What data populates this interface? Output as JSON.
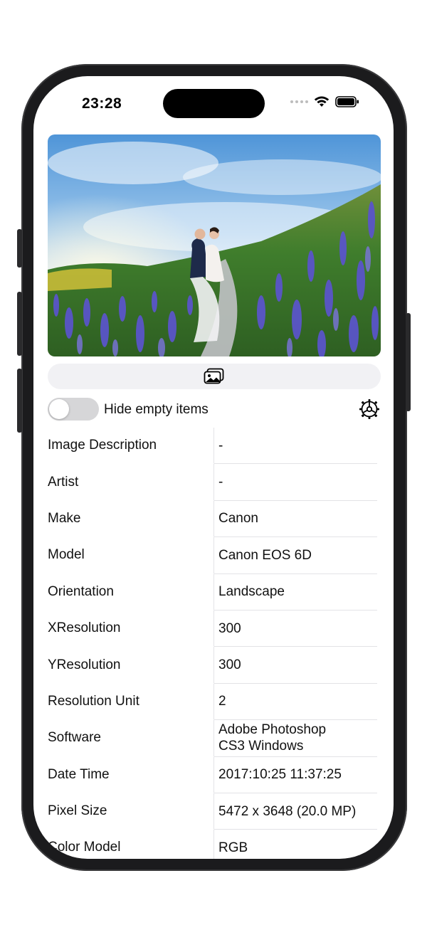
{
  "status_bar": {
    "time": "23:28",
    "signal_icon": "signal-dots-icon",
    "wifi_icon": "wifi-icon",
    "battery_icon": "battery-icon"
  },
  "photo": {
    "alt": "Couple embracing in a field of purple lavender-like flowers under a blue sky"
  },
  "picker": {
    "icon": "photos-icon"
  },
  "options": {
    "hide_empty_label": "Hide empty items",
    "hide_empty_on": false,
    "settings_icon": "gear-icon"
  },
  "exif": {
    "rows": [
      {
        "key": "Image Description",
        "value": "-"
      },
      {
        "key": "Artist",
        "value": "-"
      },
      {
        "key": "Make",
        "value": "Canon"
      },
      {
        "key": "Model",
        "value": "Canon EOS 6D"
      },
      {
        "key": "Orientation",
        "value": "Landscape"
      },
      {
        "key": "XResolution",
        "value": "300"
      },
      {
        "key": "YResolution",
        "value": "300"
      },
      {
        "key": "Resolution Unit",
        "value": "2"
      },
      {
        "key": "Software",
        "value": "Adobe Photoshop\nCS3 Windows"
      },
      {
        "key": "Date Time",
        "value": "2017:10:25 11:37:25"
      },
      {
        "key": "Pixel Size",
        "value": "5472 x 3648 (20.0 MP)"
      },
      {
        "key": "Color Model",
        "value": "RGB"
      }
    ]
  },
  "colors": {
    "toggle_off": "#d6d6d8",
    "picker_bg": "#f1f1f4",
    "divider": "#e2e2e6"
  }
}
